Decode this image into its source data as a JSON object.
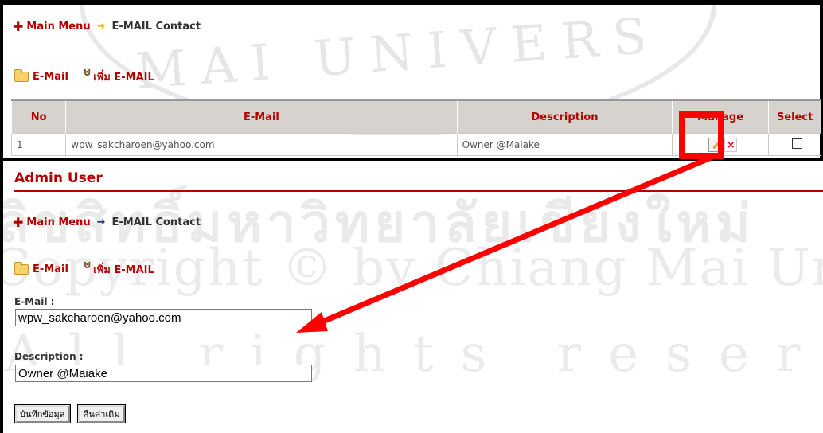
{
  "watermark": {
    "university": "MAI UNIVERS",
    "thai": "ลิขสิทธิ์มหาวิทยาลัยเชียงใหม่",
    "copyright": "Copyright © by Chiang Mai University",
    "rights": "All rights reserved"
  },
  "top": {
    "breadcrumb": {
      "main": "Main Menu",
      "current": "E-MAIL Contact",
      "arrow": "➜"
    },
    "actions": {
      "email": "E-Mail",
      "add": "เพิ่ม E-MAIL"
    },
    "table": {
      "headers": [
        "No",
        "E-Mail",
        "Description",
        "Manage",
        "Select"
      ],
      "rows": [
        {
          "no": "1",
          "email": "wpw_sakcharoen@yahoo.com",
          "description": "Owner @Maiake"
        }
      ]
    }
  },
  "bottom": {
    "title": "Admin User",
    "breadcrumb": {
      "main": "Main Menu",
      "current": "E-MAIL Contact",
      "arrow": "➔"
    },
    "actions": {
      "email": "E-Mail",
      "add": "เพิ่ม E-MAIL"
    },
    "form": {
      "email_label": "E-Mail :",
      "email_value": "wpw_sakcharoen@yahoo.com",
      "description_label": "Description :",
      "description_value": "Owner @Maiake",
      "save_label": "บันทึกข้อมูล",
      "reset_label": "คืนค่าเดิม"
    }
  },
  "colors": {
    "accent": "#b30000",
    "annotation": "#ff0000",
    "header_bg": "#d6d3ce"
  },
  "icons": [
    "plus-icon",
    "arrow-right-icon",
    "folder-icon",
    "book-icon",
    "edit-icon",
    "delete-icon",
    "checkbox-icon"
  ]
}
